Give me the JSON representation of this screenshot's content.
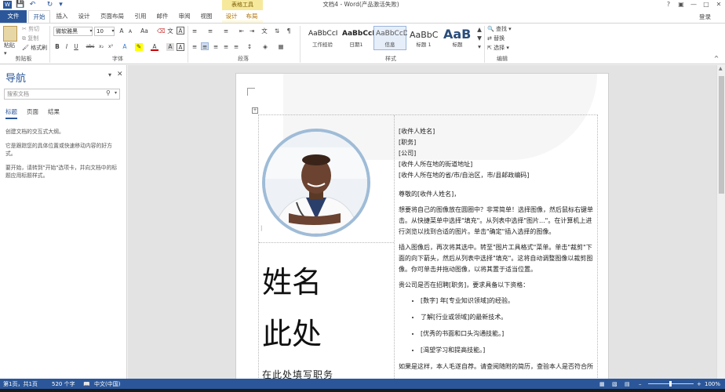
{
  "window": {
    "title": "文档4 - Word(产品激活失败)",
    "context_group": "表格工具",
    "help": "?",
    "login": "登录"
  },
  "tabs": [
    "文件",
    "开始",
    "插入",
    "设计",
    "页面布局",
    "引用",
    "邮件",
    "审阅",
    "视图",
    "设计",
    "布局"
  ],
  "ribbon": {
    "clipboard": {
      "label": "剪贴板",
      "paste": "粘贴",
      "cut": "剪切",
      "copy": "复制",
      "format_painter": "格式刷"
    },
    "font": {
      "label": "字体",
      "font_name": "微软雅黑",
      "font_size": "10"
    },
    "paragraph": {
      "label": "段落"
    },
    "styles": {
      "label": "样式",
      "items": [
        {
          "sample": "AaBbCcI",
          "name": "工作经验"
        },
        {
          "sample": "AaBbCcDc",
          "name": "日期1"
        },
        {
          "sample": "AaBbCcD",
          "name": "信息"
        },
        {
          "sample": "AaBbC",
          "name": "标题 1"
        },
        {
          "sample": "AaB",
          "name": "标题"
        }
      ]
    },
    "editing": {
      "label": "编辑",
      "find": "查找",
      "replace": "替换",
      "select": "选择"
    }
  },
  "nav": {
    "title": "导航",
    "search_placeholder": "搜索文档",
    "tabs": [
      "标题",
      "页面",
      "结果"
    ],
    "p1": "创建文档的交互式大纲。",
    "p2": "它是跟踪您的具体位置或快速移动内容的好方式。",
    "p3": "要开始，请转到\"开始\"选项卡，并向文档中的标题应用标题样式。"
  },
  "doc": {
    "name_line1": "姓名",
    "name_line2": "此处",
    "subtitle": "在此处填写职务",
    "recipient_name": "[收件人姓名]",
    "title_field": "[职务]",
    "company": "[公司]",
    "street": "[收件人所在地的街道地址]",
    "city": "[收件人所在地的省/市/自治区，市/县邮政编码]",
    "greeting": "尊敬的[收件人姓名]，",
    "para1": "想要将自己的图像放在圆圈中？非常简单！选择图像，然后鼠标右键单击。从快捷菜单中选择\"填充\"。从列表中选择\"图片...\"。在计算机上进行浏览以找到合适的图片。单击\"确定\"插入选择的图像。",
    "para2": "插入图像后，再次将其选中。转至\"图片工具格式\"菜单。单击\"裁剪\"下面的向下箭头，然后从列表中选择\"填充\"。这将自动调整图像以裁剪图像。你可单击并拖动图像，以将其置于适当位置。",
    "para3": "贵公司是否在招聘[职务]，要求具备以下资格：",
    "bullets": [
      "[数字] 年[专业知识领域]的经验。",
      "了解[行业或领域]的最新技术。",
      "[优秀的书面和口头沟通技能。]",
      "[渴望学习和提高技能。]"
    ],
    "para4": "如果是这样，本人毛遂自荐。请查阅随附的简历，查验本人是否符合所"
  },
  "status": {
    "page": "第1页，共1页",
    "words": "520 个字",
    "lang": "中文(中国)",
    "zoom": "100%"
  }
}
